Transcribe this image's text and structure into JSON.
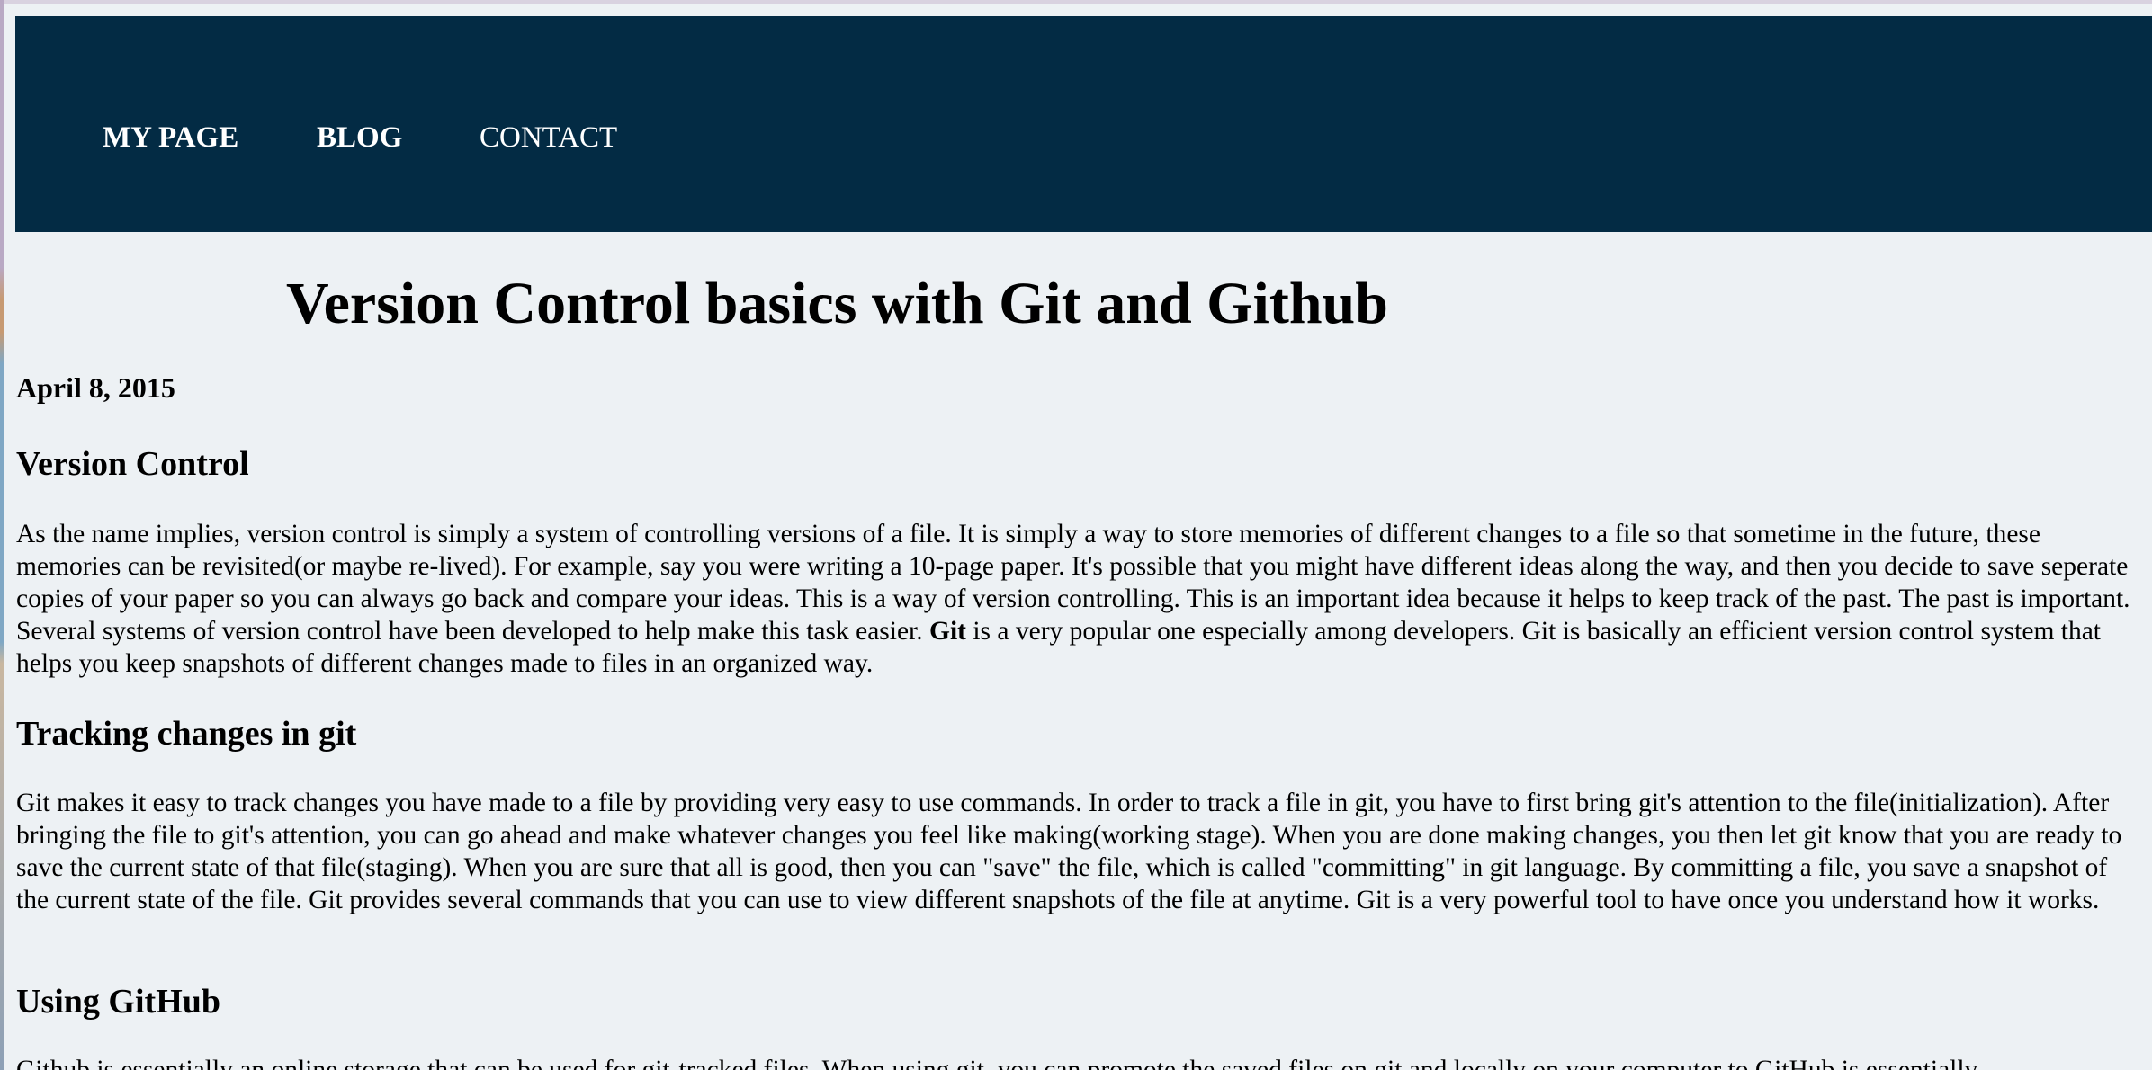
{
  "nav": {
    "items": [
      {
        "label": "MY PAGE"
      },
      {
        "label": "BLOG"
      },
      {
        "label": "CONTACT"
      }
    ]
  },
  "post": {
    "title": "Version Control basics with Git and Github",
    "date": "April 8, 2015",
    "sections": [
      {
        "heading": "Version Control",
        "text_before_bold": "As the name implies, version control is simply a system of controlling versions of a file. It is simply a way to store memories of different changes to a file so that sometime in the future, these memories can be revisited(or maybe re-lived). For example, say you were writing a 10-page paper. It's possible that you might have different ideas along the way, and then you decide to save seperate copies of your paper so you can always go back and compare your ideas. This is a way of version controlling. This is an important idea because it helps to keep track of the past. The past is important. Several systems of version control have been developed to help make this task easier. ",
        "bold": "Git",
        "text_after_bold": " is a very popular one especially among developers. Git is basically an efficient version control system that helps you keep snapshots of different changes made to files in an organized way."
      },
      {
        "heading": "Tracking changes in git",
        "text": "Git makes it easy to track changes you have made to a file by providing very easy to use commands. In order to track a file in git, you have to first bring git's attention to the file(initialization). After bringing the file to git's attention, you can go ahead and make whatever changes you feel like making(working stage). When you are done making changes, you then let git know that you are ready to save the current state of that file(staging). When you are sure that all is good, then you can \"save\" the file, which is called \"committing\" in git language. By committing a file, you save a snapshot of the current state of the file. Git provides several commands that you can use to view different snapshots of the file at anytime. Git is a very powerful tool to have once you understand how it works."
      },
      {
        "heading": "Using GitHub",
        "text": "Github is essentially an online storage that can be used for git-tracked files. When using git, you can promote the saved files on git and locally on your computer to GitHub is essentially"
      }
    ]
  },
  "colors": {
    "navbar_bg": "#032b44",
    "page_bg": "#edf1f4",
    "nav_text": "#ffffff"
  }
}
